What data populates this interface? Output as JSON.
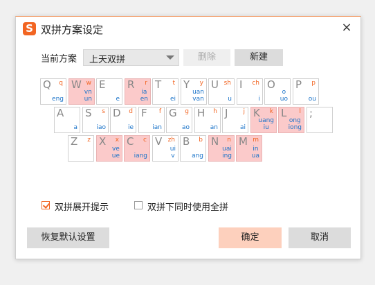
{
  "window": {
    "title": "双拼方案设定",
    "logo": "S",
    "close": "×"
  },
  "scheme": {
    "label": "当前方案",
    "selected": "上天双拼",
    "delete_label": "删除",
    "new_label": "新建"
  },
  "keys": {
    "row1": [
      {
        "letter": "Q",
        "initial": "q",
        "finals": [
          "eng"
        ],
        "highlight": false
      },
      {
        "letter": "W",
        "initial": "w",
        "finals": [
          "vn",
          "un"
        ],
        "highlight": true
      },
      {
        "letter": "E",
        "initial": "",
        "finals": [
          "e"
        ],
        "highlight": false
      },
      {
        "letter": "R",
        "initial": "r",
        "finals": [
          "ia",
          "en"
        ],
        "highlight": true
      },
      {
        "letter": "T",
        "initial": "t",
        "finals": [
          "ei"
        ],
        "highlight": false
      },
      {
        "letter": "Y",
        "initial": "y",
        "finals": [
          "uan",
          "van"
        ],
        "highlight": false
      },
      {
        "letter": "U",
        "initial": "sh",
        "finals": [
          "u"
        ],
        "highlight": false
      },
      {
        "letter": "I",
        "initial": "ch",
        "finals": [
          "i"
        ],
        "highlight": false
      },
      {
        "letter": "O",
        "initial": "",
        "finals": [
          "o",
          "uo"
        ],
        "highlight": false
      },
      {
        "letter": "P",
        "initial": "p",
        "finals": [
          "ou"
        ],
        "highlight": false
      }
    ],
    "row2": [
      {
        "letter": "A",
        "initial": "",
        "finals": [
          "a"
        ],
        "highlight": false
      },
      {
        "letter": "S",
        "initial": "s",
        "finals": [
          "iao"
        ],
        "highlight": false
      },
      {
        "letter": "D",
        "initial": "d",
        "finals": [
          "ie"
        ],
        "highlight": false
      },
      {
        "letter": "F",
        "initial": "f",
        "finals": [
          "ian"
        ],
        "highlight": false
      },
      {
        "letter": "G",
        "initial": "g",
        "finals": [
          "ao"
        ],
        "highlight": false
      },
      {
        "letter": "H",
        "initial": "h",
        "finals": [
          "an"
        ],
        "highlight": false
      },
      {
        "letter": "J",
        "initial": "j",
        "finals": [
          "ai"
        ],
        "highlight": false
      },
      {
        "letter": "K",
        "initial": "k",
        "finals": [
          "uang",
          "iu"
        ],
        "highlight": true
      },
      {
        "letter": "L",
        "initial": "l",
        "finals": [
          "ong",
          "iong"
        ],
        "highlight": true
      },
      {
        "letter": ";",
        "initial": "",
        "finals": [],
        "highlight": false
      }
    ],
    "row3": [
      {
        "letter": "Z",
        "initial": "z",
        "finals": [],
        "highlight": false
      },
      {
        "letter": "X",
        "initial": "x",
        "finals": [
          "ve",
          "ue"
        ],
        "highlight": true
      },
      {
        "letter": "C",
        "initial": "c",
        "finals": [
          "iang"
        ],
        "highlight": true
      },
      {
        "letter": "V",
        "initial": "zh",
        "finals": [
          "ui",
          "v"
        ],
        "highlight": false
      },
      {
        "letter": "B",
        "initial": "b",
        "finals": [
          "ang"
        ],
        "highlight": false
      },
      {
        "letter": "N",
        "initial": "n",
        "finals": [
          "uai",
          "ing"
        ],
        "highlight": true
      },
      {
        "letter": "M",
        "initial": "m",
        "finals": [
          "in",
          "ua"
        ],
        "highlight": true
      }
    ]
  },
  "options": {
    "show_hint": {
      "label": "双拼展开提示",
      "checked": true
    },
    "full_pinyin": {
      "label": "双拼下同时使用全拼",
      "checked": false
    }
  },
  "buttons": {
    "reset": "恢复默认设置",
    "ok": "确定",
    "cancel": "取消"
  },
  "colors": {
    "accent": "#f26522",
    "highlight_key": "#fbcaca",
    "ok_button": "#fdd0bd",
    "gray_button": "#dcdcdc"
  }
}
